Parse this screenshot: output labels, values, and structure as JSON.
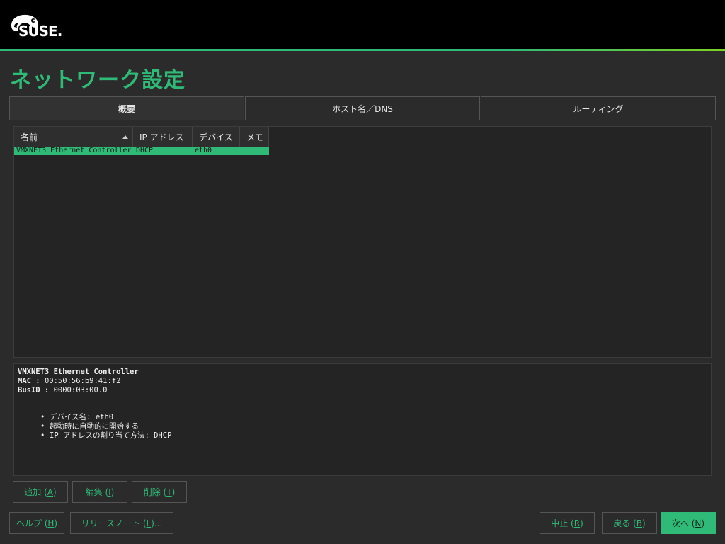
{
  "brand": {
    "logo_text": "SUSE.",
    "accent_color": "#30ba78"
  },
  "page": {
    "title": "ネットワーク設定"
  },
  "tabs": [
    {
      "label": "概要",
      "active": true
    },
    {
      "label": "ホスト名／DNS",
      "active": false
    },
    {
      "label": "ルーティング",
      "active": false
    }
  ],
  "table": {
    "columns": [
      "名前",
      "IP アドレス",
      "デバイス",
      "メモ"
    ],
    "rows": [
      {
        "name": "VMXNET3 Ethernet Controller",
        "ip": "DHCP",
        "device": "eth0",
        "memo": ""
      }
    ]
  },
  "details": {
    "title": "VMXNET3 Ethernet Controller",
    "mac_label": "MAC :",
    "mac_value": "00:50:56:b9:41:f2",
    "busid_label": "BusID :",
    "busid_value": "0000:03:00.0",
    "bullets": [
      "デバイス名: eth0",
      "起動時に自動的に開始する",
      "IP アドレスの割り当て方法: DHCP"
    ]
  },
  "actions": {
    "add": {
      "label": "追加 (",
      "key": "A",
      "end": ")"
    },
    "edit": {
      "label": "編集 (",
      "key": "I",
      "end": ")"
    },
    "delete": {
      "label": "削除 (",
      "key": "T",
      "end": ")"
    }
  },
  "footer": {
    "help": {
      "label": "ヘルプ (",
      "key": "H",
      "end": ")"
    },
    "notes": {
      "label": "リリースノート (",
      "key": "L",
      "end": ")..."
    },
    "abort": {
      "label": "中止 (",
      "key": "R",
      "end": ")"
    },
    "back": {
      "label": "戻る (",
      "key": "B",
      "end": ")"
    },
    "next": {
      "label": "次へ (",
      "key": "N",
      "end": ")"
    }
  }
}
